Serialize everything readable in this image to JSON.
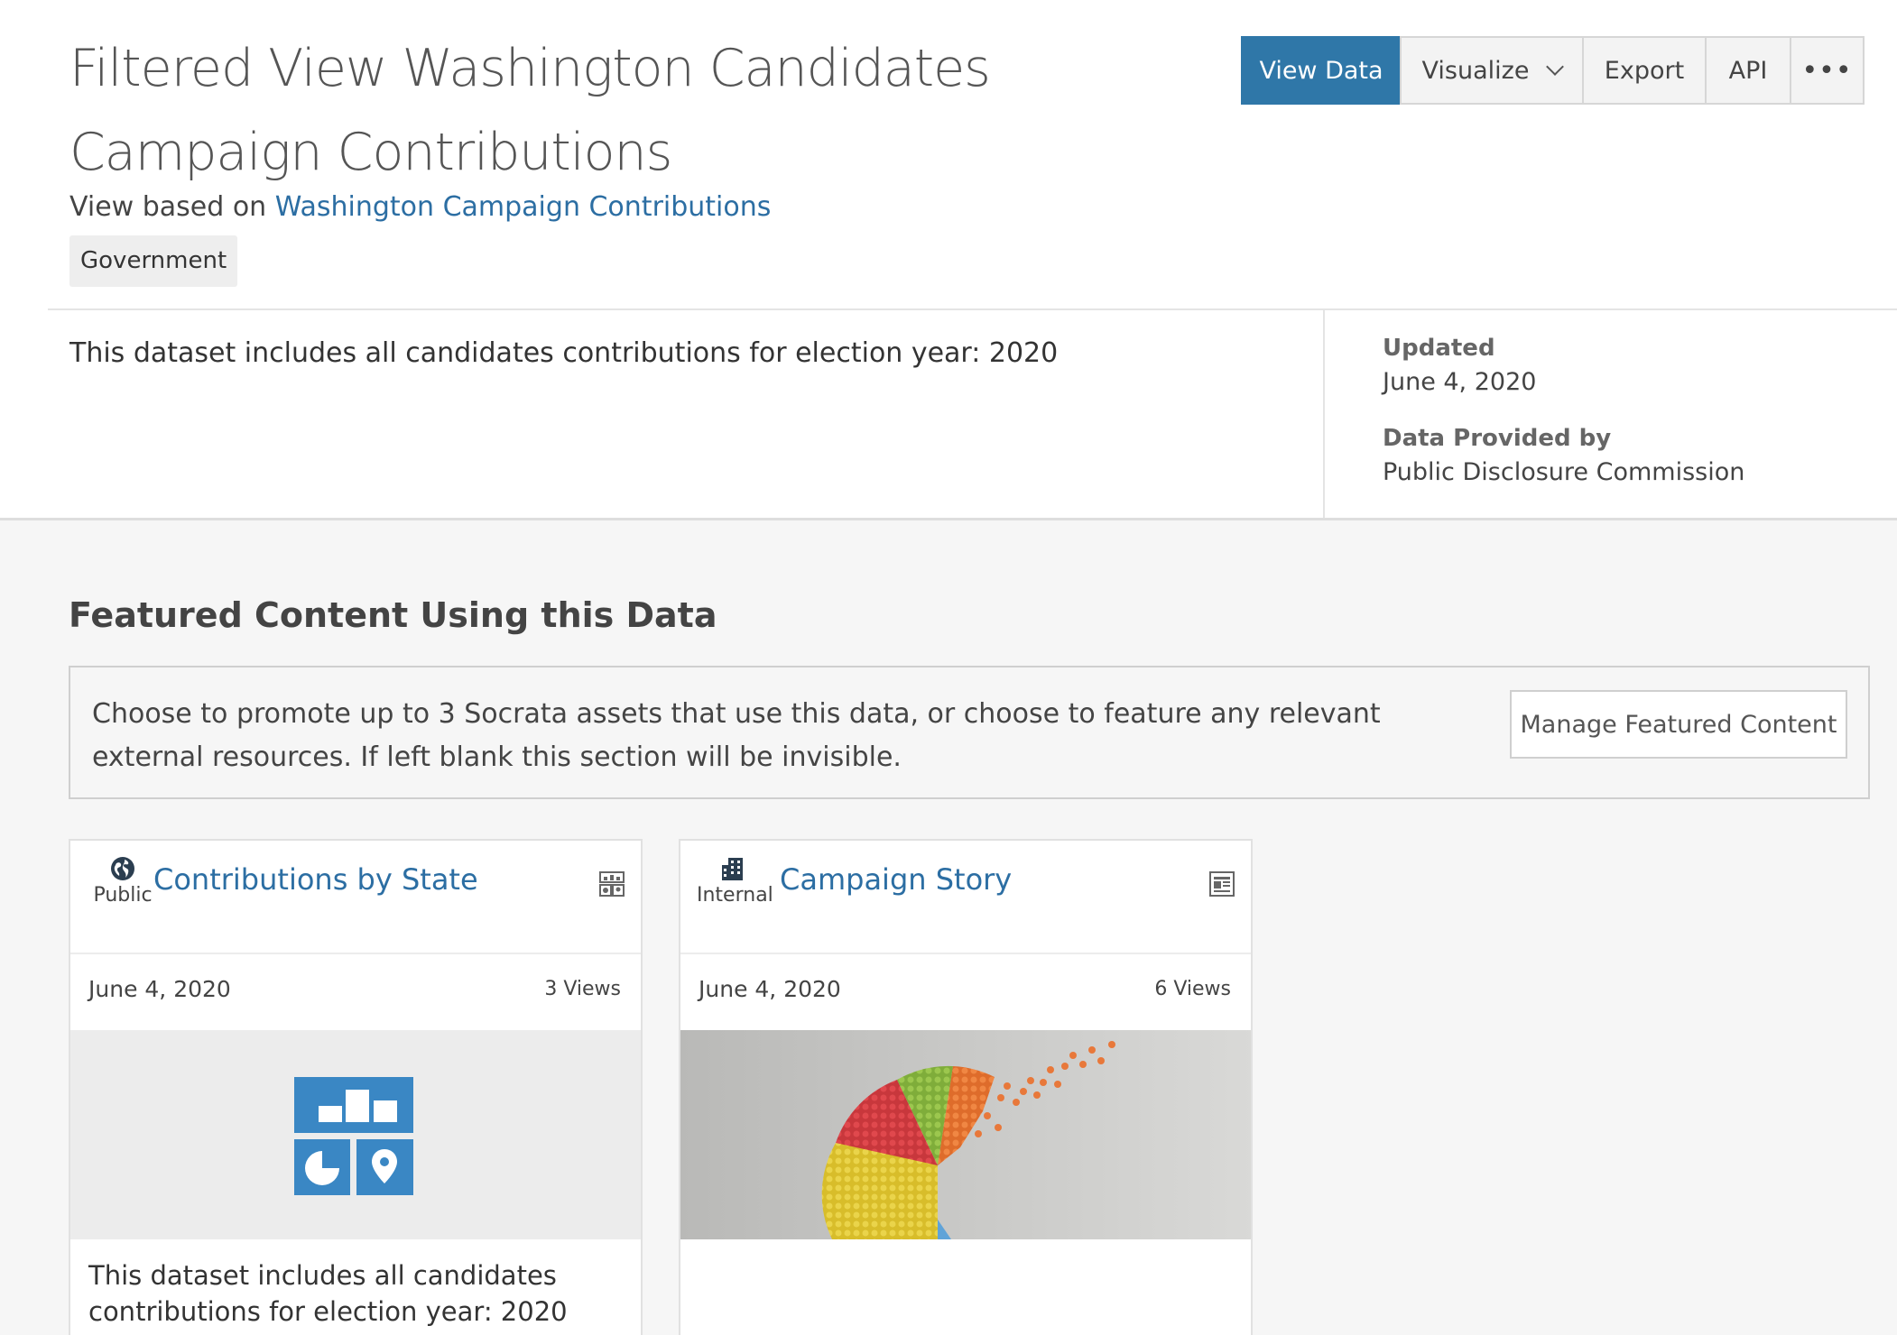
{
  "page": {
    "title": "Filtered View Washington Candidates Campaign Contributions",
    "based_on_prefix": "View based on",
    "based_on_link": "Washington Campaign Contributions",
    "category": "Government",
    "description": "This dataset includes all candidates contributions for election year: 2020"
  },
  "actions": {
    "view_data": "View Data",
    "visualize": "Visualize",
    "export": "Export",
    "api": "API",
    "more": "•••"
  },
  "meta": {
    "updated_label": "Updated",
    "updated_value": "June 4, 2020",
    "provider_label": "Data Provided by",
    "provider_value": "Public Disclosure Commission"
  },
  "featured": {
    "title": "Featured Content Using this Data",
    "promo_text": "Choose to promote up to 3 Socrata assets that use this data, or choose to feature any relevant external resources. If left blank this section will be invisible.",
    "manage_button": "Manage Featured Content",
    "cards": [
      {
        "title": "Contributions by State",
        "audience": "Public",
        "audience_icon": "globe-icon",
        "type_icon": "dashboard-icon",
        "date": "June 4, 2020",
        "views": "3 Views",
        "description": "This dataset includes all candidates contributions for election year: 2020"
      },
      {
        "title": "Campaign Story",
        "audience": "Internal",
        "audience_icon": "building-icon",
        "type_icon": "story-icon",
        "date": "June 4, 2020",
        "views": "6 Views",
        "description": ""
      }
    ]
  },
  "colors": {
    "primary": "#2f77a8",
    "link": "#2c6ea3",
    "tile": "#3a87c4"
  }
}
